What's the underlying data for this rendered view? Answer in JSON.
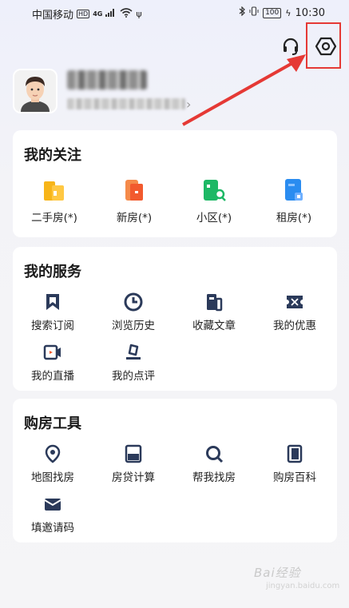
{
  "status_bar": {
    "carrier": "中国移动",
    "hd": "HD",
    "network": "4G",
    "battery": "100",
    "time": "10:30"
  },
  "header": {
    "icons": [
      "headset-icon",
      "settings-icon"
    ]
  },
  "follow": {
    "title": "我的关注",
    "items": [
      {
        "label": "二手房(*)",
        "icon": "second-hand-house-icon",
        "color": "#f7b519"
      },
      {
        "label": "新房(*)",
        "icon": "new-house-icon",
        "color": "#f25a2e"
      },
      {
        "label": "小区(*)",
        "icon": "community-icon",
        "color": "#1db865"
      },
      {
        "label": "租房(*)",
        "icon": "rent-house-icon",
        "color": "#2a8cf0"
      }
    ]
  },
  "services": {
    "title": "我的服务",
    "items": [
      {
        "label": "搜索订阅",
        "icon": "bookmark-icon"
      },
      {
        "label": "浏览历史",
        "icon": "clock-icon"
      },
      {
        "label": "收藏文章",
        "icon": "article-icon"
      },
      {
        "label": "我的优惠",
        "icon": "coupon-icon"
      },
      {
        "label": "我的直播",
        "icon": "live-icon"
      },
      {
        "label": "我的点评",
        "icon": "review-icon"
      }
    ]
  },
  "tools": {
    "title": "购房工具",
    "items": [
      {
        "label": "地图找房",
        "icon": "map-pin-icon"
      },
      {
        "label": "房贷计算",
        "icon": "calculator-icon"
      },
      {
        "label": "帮我找房",
        "icon": "search-icon"
      },
      {
        "label": "购房百科",
        "icon": "book-icon"
      },
      {
        "label": "填邀请码",
        "icon": "envelope-icon"
      }
    ]
  },
  "watermark": "Bai经验",
  "watermark_sub": "jingyan.baidu.com"
}
